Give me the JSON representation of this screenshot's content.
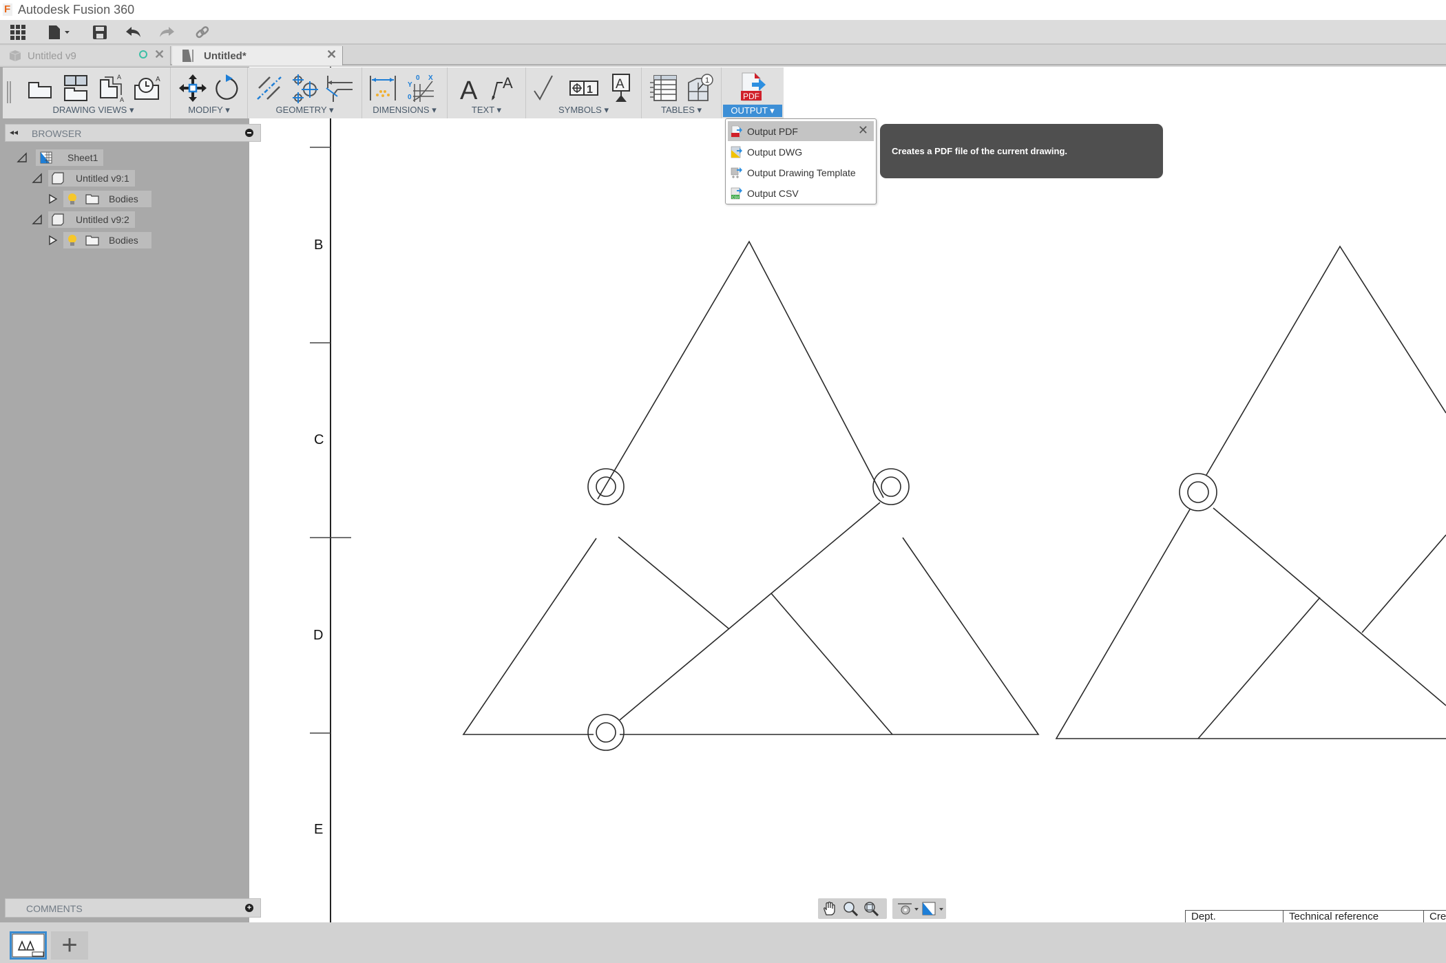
{
  "app": {
    "title": "Autodesk Fusion 360",
    "logo_letter": "F"
  },
  "quick_access": {
    "items": [
      {
        "name": "data-panel",
        "icon": "grid-icon"
      },
      {
        "name": "file-menu",
        "icon": "file-icon"
      },
      {
        "name": "save",
        "icon": "save-icon"
      },
      {
        "name": "undo",
        "icon": "undo-icon"
      },
      {
        "name": "redo",
        "icon": "redo-icon"
      },
      {
        "name": "link",
        "icon": "link-icon"
      }
    ]
  },
  "tabs": [
    {
      "label": "Untitled v9",
      "active": false,
      "status": "circle"
    },
    {
      "label": "Untitled*",
      "active": true
    }
  ],
  "ribbon": {
    "groups": [
      {
        "label": "DRAWING VIEWS ▾",
        "icons": [
          "base-view-icon",
          "projected-view-icon",
          "section-view-icon",
          "detail-view-icon"
        ]
      },
      {
        "label": "MODIFY ▾",
        "icons": [
          "move-icon",
          "rotate-icon"
        ]
      },
      {
        "label": "GEOMETRY ▾",
        "icons": [
          "centerline-icon",
          "center-mark-icon",
          "edge-extension-icon"
        ]
      },
      {
        "label": "DIMENSIONS ▾",
        "icons": [
          "dimension-icon",
          "ordinate-dimension-icon"
        ]
      },
      {
        "label": "TEXT ▾",
        "icons": [
          "text-icon",
          "leader-text-icon"
        ]
      },
      {
        "label": "SYMBOLS ▾",
        "icons": [
          "surface-texture-icon",
          "feature-control-frame-icon",
          "datum-identifier-icon"
        ]
      },
      {
        "label": "TABLES ▾",
        "icons": [
          "table-icon",
          "balloon-icon"
        ]
      },
      {
        "label": "OUTPUT ▾",
        "icons": [
          "output-pdf-icon"
        ],
        "active": true
      }
    ]
  },
  "browser": {
    "title": "BROWSER",
    "tree": [
      {
        "label": "Sheet1",
        "level": 0,
        "expanded": true,
        "icon": "sheet-icon"
      },
      {
        "label": "Untitled v9:1",
        "level": 1,
        "expanded": true,
        "icon": "component-icon"
      },
      {
        "label": "Bodies",
        "level": 2,
        "expanded": false,
        "icon": "folder-icon",
        "visible": true
      },
      {
        "label": "Untitled v9:2",
        "level": 1,
        "expanded": true,
        "icon": "component-icon"
      },
      {
        "label": "Bodies",
        "level": 2,
        "expanded": false,
        "icon": "folder-icon",
        "visible": true
      }
    ]
  },
  "comments": {
    "title": "COMMENTS"
  },
  "output_menu": {
    "items": [
      {
        "label": "Output PDF",
        "icon": "pdf-icon",
        "hover": true
      },
      {
        "label": "Output DWG",
        "icon": "dwg-icon"
      },
      {
        "label": "Output Drawing Template",
        "icon": "template-icon"
      },
      {
        "label": "Output CSV",
        "icon": "csv-icon"
      }
    ]
  },
  "tooltip": {
    "text": "Creates a PDF file of the current drawing."
  },
  "drawing": {
    "row_labels": [
      "B",
      "C",
      "D",
      "E"
    ],
    "title_block": [
      "Dept.",
      "Technical reference",
      "Created by"
    ]
  },
  "navbar": {
    "items": [
      "pan-icon",
      "zoom-window-icon",
      "fit-icon",
      "display-settings-icon",
      "sheet-settings-icon"
    ]
  },
  "sheets": {
    "add_label": "+"
  }
}
